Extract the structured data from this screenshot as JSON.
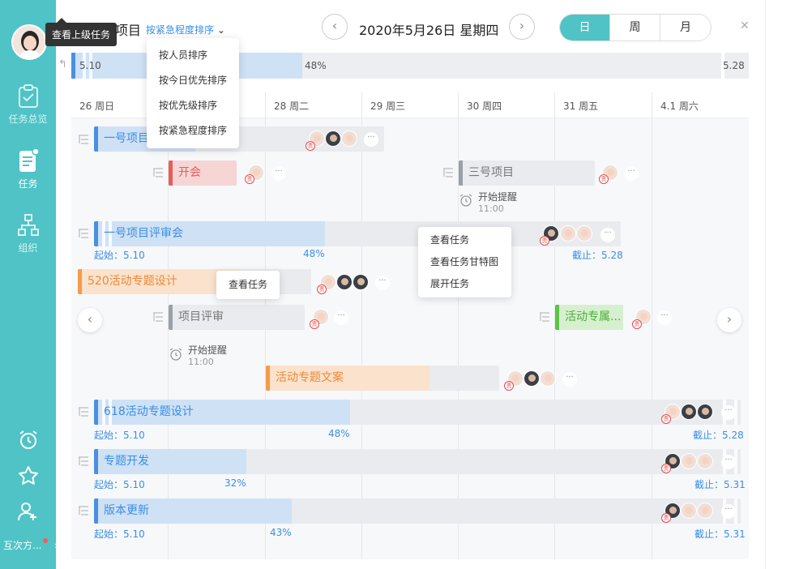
{
  "sidebar": {
    "tooltip": "查看上级任务",
    "items": [
      {
        "label": "任务总览"
      },
      {
        "label": "任务"
      },
      {
        "label": "组织"
      }
    ],
    "footer_label": "互次方..."
  },
  "header": {
    "title": "项目",
    "sort_label": "按紧急程度排序",
    "date": "2020年5月26日 星期四",
    "views": [
      "日",
      "周",
      "月"
    ],
    "active_view": "日"
  },
  "sort_menu": [
    "按人员排序",
    "按今日优先排序",
    "按优先级排序",
    "按紧急程度排序"
  ],
  "overview": {
    "start": "5.10",
    "percent": "48%",
    "end": "5.28"
  },
  "days": [
    "26 周日",
    "28 周二",
    "29 周三",
    "30 周四",
    "31 周五",
    "4.1 周六"
  ],
  "tasks": [
    {
      "name": "一号项目"
    },
    {
      "name": "开会"
    },
    {
      "name": "三号项目"
    },
    {
      "name": "一号项目评审会",
      "start": "起始：5.10",
      "percent": "48%",
      "end": "截止：5.28"
    },
    {
      "name": "520活动专题设计"
    },
    {
      "name": "项目评审"
    },
    {
      "name": "活动专属..."
    },
    {
      "name": "活动专题文案"
    },
    {
      "name": "618活动专题设计",
      "start": "起始：5.10",
      "percent": "48%",
      "end": "截止：5.28"
    },
    {
      "name": "专题开发",
      "start": "起始：5.10",
      "percent": "32%",
      "end": "截止：5.31"
    },
    {
      "name": "版本更新",
      "start": "起始：5.10",
      "percent": "43%",
      "end": "截止：5.31"
    }
  ],
  "reminders": [
    {
      "label": "开始提醒",
      "time": "11:00"
    },
    {
      "label": "开始提醒",
      "time": "11:00"
    }
  ],
  "context_menu_1": [
    "查看任务"
  ],
  "context_menu_2": [
    "查看任务",
    "查看任务甘特图",
    "展开任务"
  ],
  "resp_badge": "责",
  "more_label": "···",
  "colors": {
    "accent": "#4fc3c6",
    "blue": "#4a90e2",
    "red": "#e85c5c",
    "gray": "#9aa0a8",
    "orange": "#f59a4a",
    "green": "#5ac443"
  }
}
